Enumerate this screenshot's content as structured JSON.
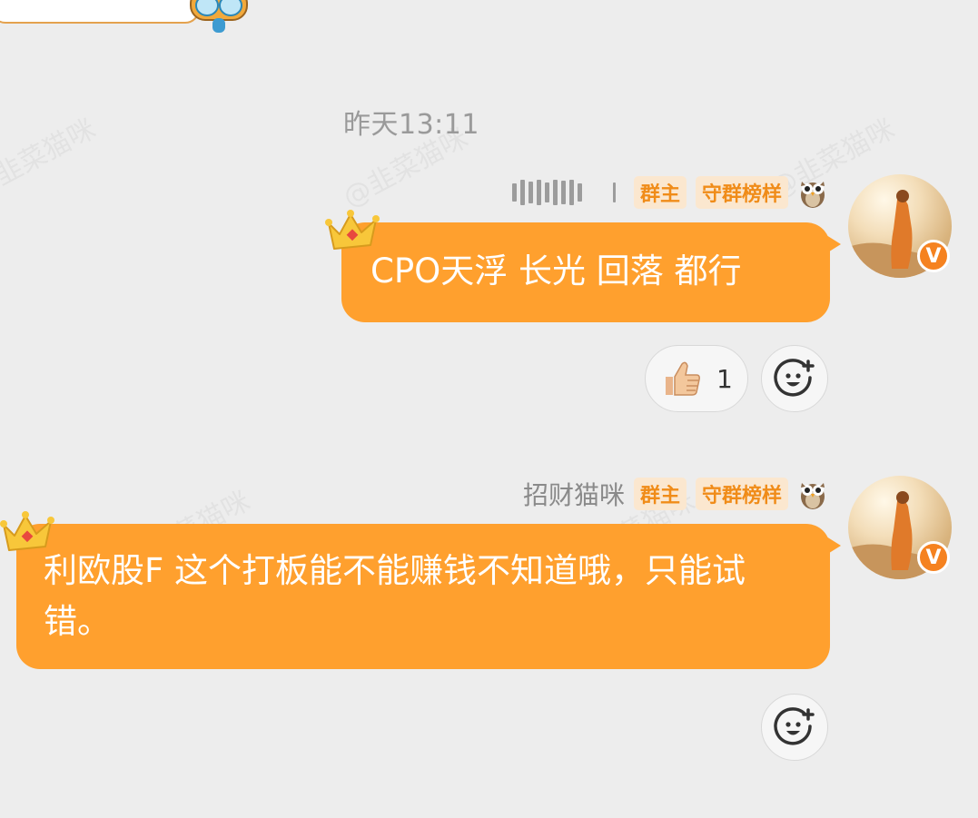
{
  "watermark": {
    "text": "@韭菜猫咪"
  },
  "chat": {
    "timestamp": "昨天13:11",
    "messages": [
      {
        "sender": "",
        "badges": [
          "群主",
          "守群榜样"
        ],
        "text": "CPO天浮  长光  回落  都行",
        "reactions": [
          {
            "icon": "thumbs-up-icon",
            "count": "1"
          }
        ]
      },
      {
        "sender": "招财猫咪",
        "badges": [
          "群主",
          "守群榜样"
        ],
        "text": "利欧股F  这个打板能不能赚钱不知道哦，只能试错。",
        "reactions": []
      }
    ],
    "avatar_badge": "V"
  },
  "colors": {
    "bubble": "#ffa02e",
    "badge_text": "#f08c19",
    "badge_bg": "#fbe7cf",
    "background": "#ededed"
  }
}
